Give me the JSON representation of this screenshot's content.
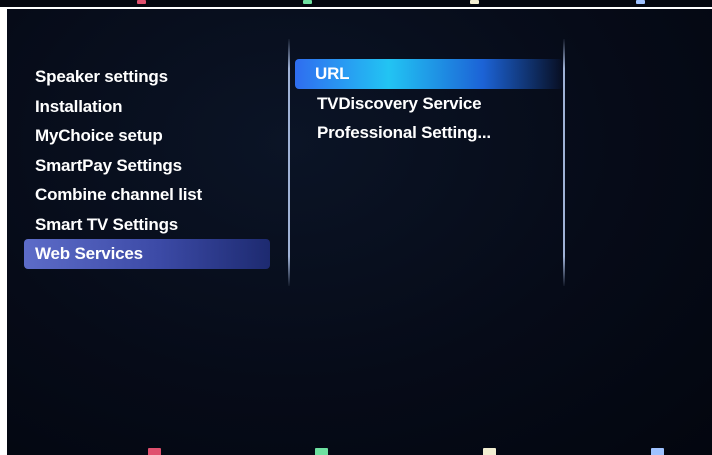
{
  "left_menu": {
    "items": [
      {
        "label": "Speaker settings",
        "selected": false
      },
      {
        "label": "Installation",
        "selected": false
      },
      {
        "label": "MyChoice setup",
        "selected": false
      },
      {
        "label": "SmartPay Settings",
        "selected": false
      },
      {
        "label": "Combine channel list",
        "selected": false
      },
      {
        "label": "Smart TV Settings",
        "selected": false
      },
      {
        "label": "Web Services",
        "selected": true
      }
    ]
  },
  "right_menu": {
    "items": [
      {
        "label": "URL",
        "selected": true
      },
      {
        "label": "TVDiscovery Service",
        "selected": false
      },
      {
        "label": "Professional Setting...",
        "selected": false
      }
    ]
  },
  "color_keys": {
    "red": "#e0506e",
    "green": "#6ee0a0",
    "yellow": "#f2eed2",
    "blue": "#9fc2ff"
  }
}
